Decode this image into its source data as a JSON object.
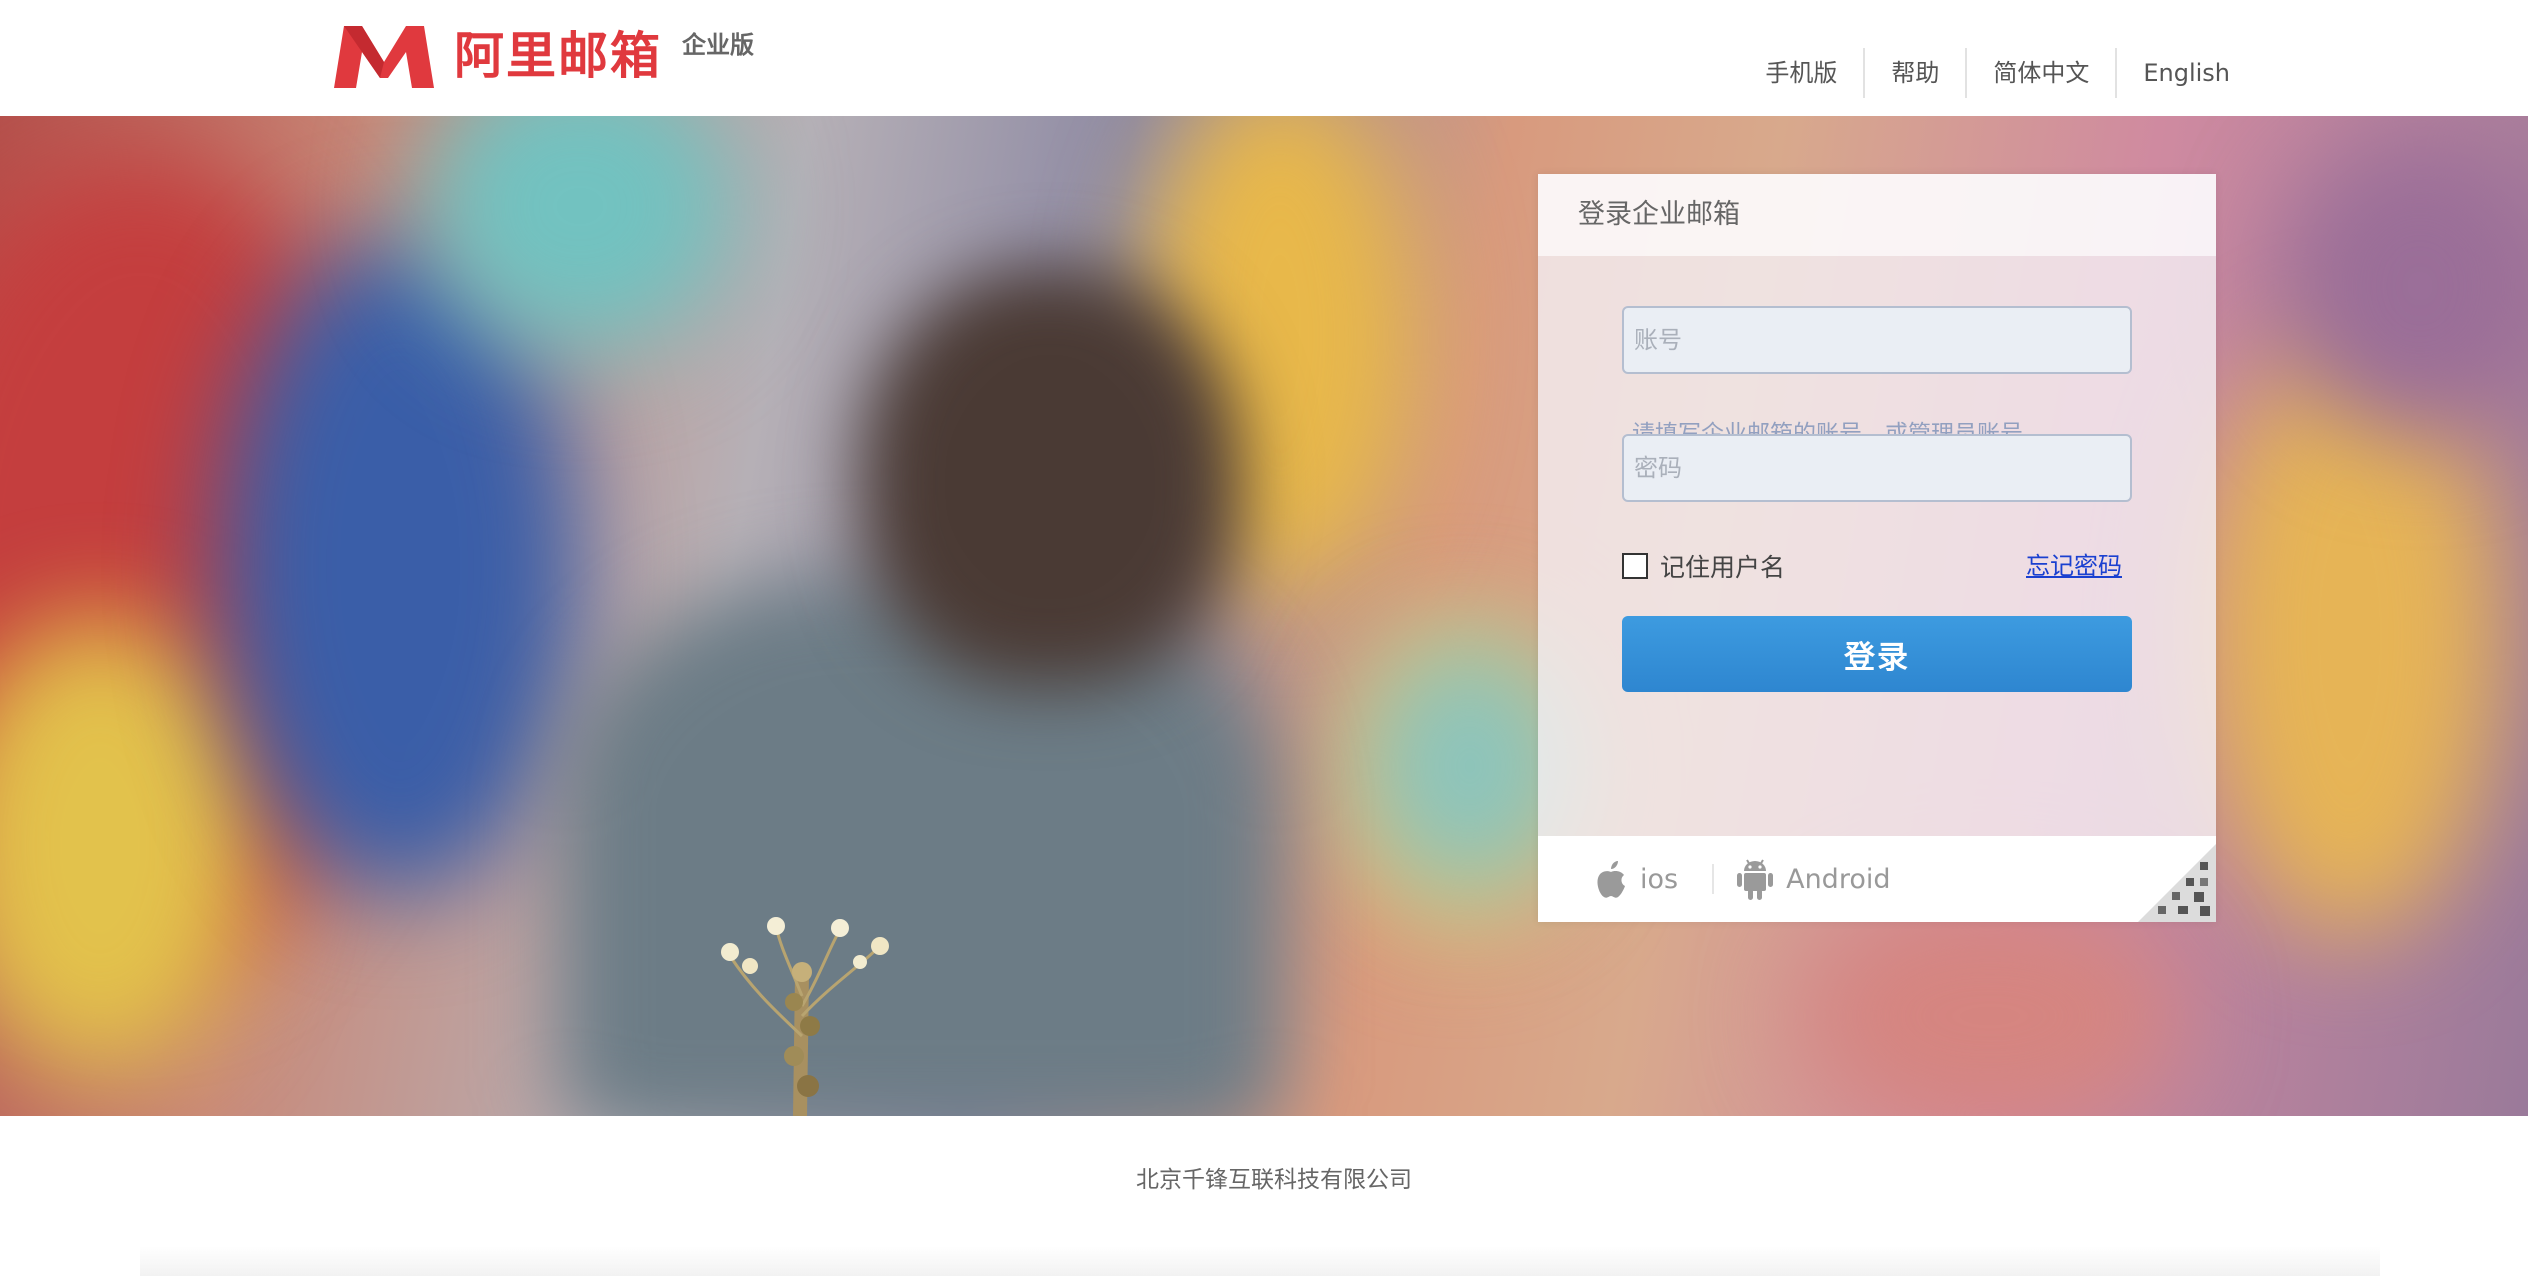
{
  "header": {
    "logo_text": "阿里邮箱",
    "logo_edition": "企业版",
    "nav": {
      "mobile": "手机版",
      "help": "帮助",
      "lang_cn": "简体中文",
      "lang_en": "English"
    }
  },
  "login": {
    "title": "登录企业邮箱",
    "account_placeholder": "账号",
    "account_hint": "请填写企业邮箱的账号，或管理员账号。",
    "password_placeholder": "密码",
    "remember_label": "记住用户名",
    "remember_checked": false,
    "forgot_link": "忘记密码",
    "submit_label": "登录",
    "apps": {
      "ios_label": "ios",
      "android_label": "Android"
    }
  },
  "footer": {
    "company": "北京千锋互联科技有限公司"
  },
  "colors": {
    "brand_red": "#e0393e",
    "button_blue": "#3d9be0",
    "link_blue": "#1a40d0",
    "hint_text": "#92a0c0"
  },
  "icons": [
    "logo-m-icon",
    "apple-icon",
    "android-icon",
    "qr-code-icon"
  ]
}
